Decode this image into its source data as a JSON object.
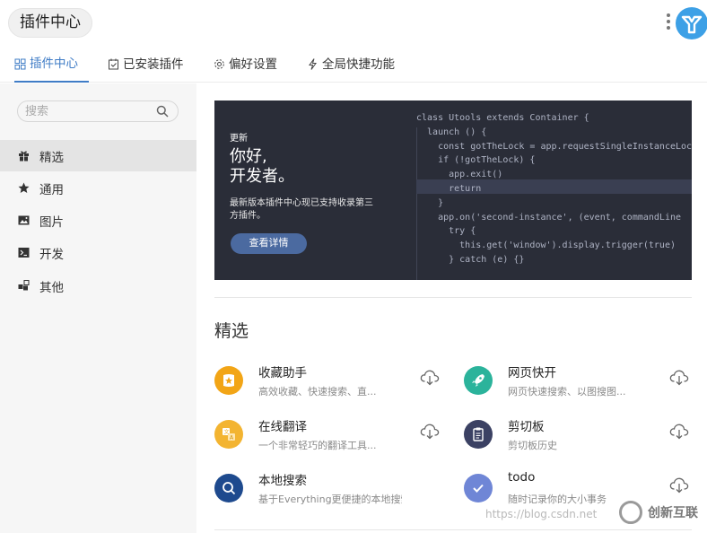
{
  "app": {
    "title": "插件中心"
  },
  "tabs": [
    {
      "label": "插件中心",
      "icon": "grid-icon",
      "active": true
    },
    {
      "label": "已安装插件",
      "icon": "installed-icon"
    },
    {
      "label": "偏好设置",
      "icon": "gear-icon"
    },
    {
      "label": "全局快捷功能",
      "icon": "lightning-icon"
    }
  ],
  "sidebar": {
    "search": {
      "placeholder": "搜索",
      "value": ""
    },
    "items": [
      {
        "label": "精选",
        "icon": "gift-icon",
        "active": true
      },
      {
        "label": "通用",
        "icon": "star-icon"
      },
      {
        "label": "图片",
        "icon": "image-icon"
      },
      {
        "label": "开发",
        "icon": "terminal-icon"
      },
      {
        "label": "其他",
        "icon": "blocks-icon"
      }
    ]
  },
  "banner": {
    "tag": "更新",
    "title_line1": "你好,",
    "title_line2": "开发者。",
    "desc": "最新版本插件中心现已支持收录第三方插件。",
    "button": "查看详情",
    "code_lines": [
      "class Utools extends Container {",
      "  launch () {",
      "    const gotTheLock = app.requestSingleInstanceLock()",
      "    if (!gotTheLock) {",
      "      app.exit()",
      "      return",
      "    }",
      "",
      "    app.on('second-instance', (event, commandLine",
      "      try {",
      "        this.get('window').display.trigger(true)",
      "      } catch (e) {}"
    ]
  },
  "section": {
    "title": "精选"
  },
  "plugins": [
    {
      "name": "收藏助手",
      "desc": "高效收藏、快速搜索、直...",
      "icon": "favorites-icon",
      "color": "#f2a516"
    },
    {
      "name": "网页快开",
      "desc": "网页快速搜索、以图搜图...",
      "icon": "rocket-icon",
      "color": "#2bb39b"
    },
    {
      "name": "在线翻译",
      "desc": "一个非常轻巧的翻译工具...",
      "icon": "translate-icon",
      "color": "#f3b431"
    },
    {
      "name": "剪切板",
      "desc": "剪切板历史",
      "icon": "clipboard-icon",
      "color": "#3b4163"
    },
    {
      "name": "本地搜索",
      "desc": "基于Everything更便捷的本地搜索",
      "icon": "search-icon",
      "color": "#1e4a8e"
    },
    {
      "name": "todo",
      "desc": "随时记录你的大小事务",
      "icon": "check-icon",
      "color": "#6f86d6"
    }
  ],
  "watermark": {
    "url": "https://blog.csdn.net",
    "brand": "创新互联"
  },
  "colors": {
    "accent": "#3f7cc6",
    "sidebar_bg": "#f6f6f6",
    "banner_bg": "#2a2d38"
  }
}
